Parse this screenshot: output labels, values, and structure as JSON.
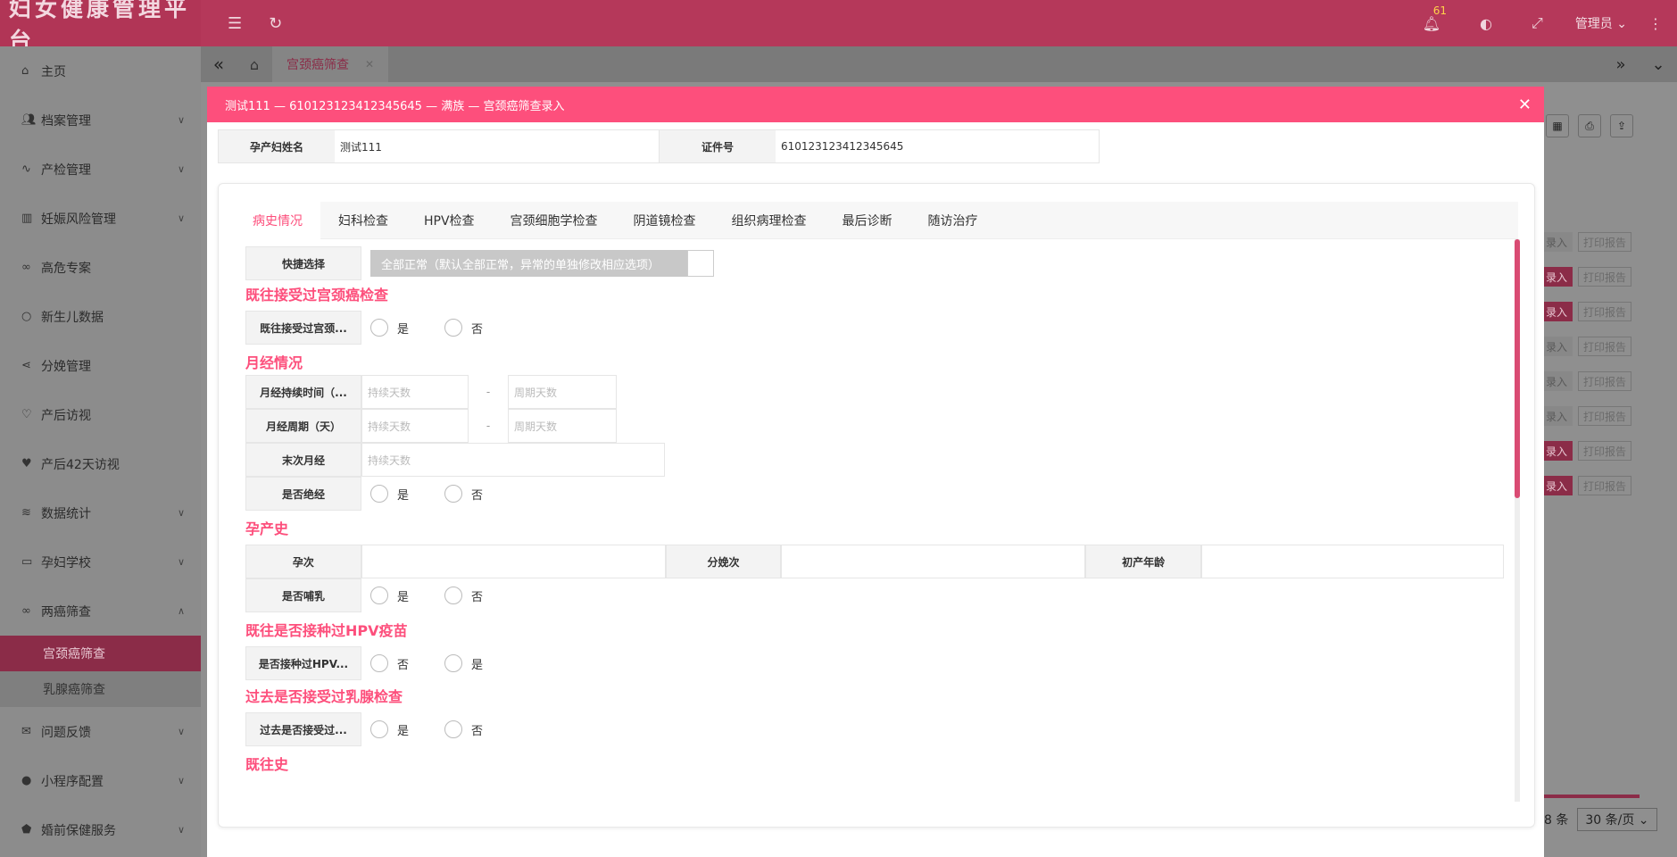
{
  "app": {
    "title": "妇女健康管理平台",
    "notification_count": "61",
    "user": "管理员"
  },
  "sidebar": {
    "items": [
      {
        "label": "主页",
        "icon": "home-icon"
      },
      {
        "label": "档案管理",
        "icon": "users-icon"
      },
      {
        "label": "产检管理",
        "icon": "pulse-icon"
      },
      {
        "label": "妊娠风险管理",
        "icon": "table-icon"
      },
      {
        "label": "高危专案",
        "icon": "link-icon"
      },
      {
        "label": "新生儿数据",
        "icon": "circle-icon"
      },
      {
        "label": "分娩管理",
        "icon": "share-icon"
      },
      {
        "label": "产后访视",
        "icon": "heart-outline-icon"
      },
      {
        "label": "产后42天访视",
        "icon": "heart-icon"
      },
      {
        "label": "数据统计",
        "icon": "layers-icon"
      },
      {
        "label": "孕妇学校",
        "icon": "book-icon"
      },
      {
        "label": "两癌筛查",
        "icon": "link-icon"
      }
    ],
    "sub_items": [
      {
        "label": "宫颈癌筛查",
        "active": true
      },
      {
        "label": "乳腺癌筛查",
        "active": false
      }
    ],
    "bottom_items": [
      {
        "label": "问题反馈",
        "icon": "mail-icon"
      },
      {
        "label": "小程序配置",
        "icon": "wechat-icon"
      },
      {
        "label": "婚前保健服务",
        "icon": "shield-icon"
      }
    ]
  },
  "tabbar": {
    "active_tab": "宫颈癌筛查"
  },
  "background": {
    "row_entry_label": "录入",
    "row_print_label": "打印报告",
    "total_suffix": "8 条",
    "page_size": "30 条/页"
  },
  "modal": {
    "title": "测试111 — 610123123412345645 — 满族 — 宫颈癌筛查录入",
    "patient_name_label": "孕产妇姓名",
    "patient_name": "测试111",
    "id_label": "证件号",
    "id_value": "610123123412345645",
    "tabs": [
      "病史情况",
      "妇科检查",
      "HPV检查",
      "宫颈细胞学检查",
      "阴道镜检查",
      "组织病理检查",
      "最后诊断",
      "随访治疗"
    ],
    "quick_label": "快捷选择",
    "quick_text": "全部正常（默认全部正常，异常的单独修改相应选项）",
    "sec1_title": "既往接受过宫颈癌检查",
    "sec1_label": "既往接受过宫颈...",
    "yes": "是",
    "no": "否",
    "sec2_title": "月经情况",
    "mens_duration_label": "月经持续时间（...",
    "mens_cycle_label": "月经周期（天）",
    "last_mens_label": "末次月经",
    "menopause_label": "是否绝经",
    "placeholder_duration": "持续天数",
    "placeholder_cycle": "周期天数",
    "dash": "-",
    "sec3_title": "孕产史",
    "pregnancy_label": "孕次",
    "delivery_label": "分娩次",
    "first_age_label": "初产年龄",
    "breastfeed_label": "是否哺乳",
    "sec4_title": "既往是否接种过HPV疫苗",
    "hpv_label": "是否接种过HPV...",
    "sec5_title": "过去是否接受过乳腺检查",
    "breast_label": "过去是否接受过...",
    "sec6_title": "既往史"
  }
}
